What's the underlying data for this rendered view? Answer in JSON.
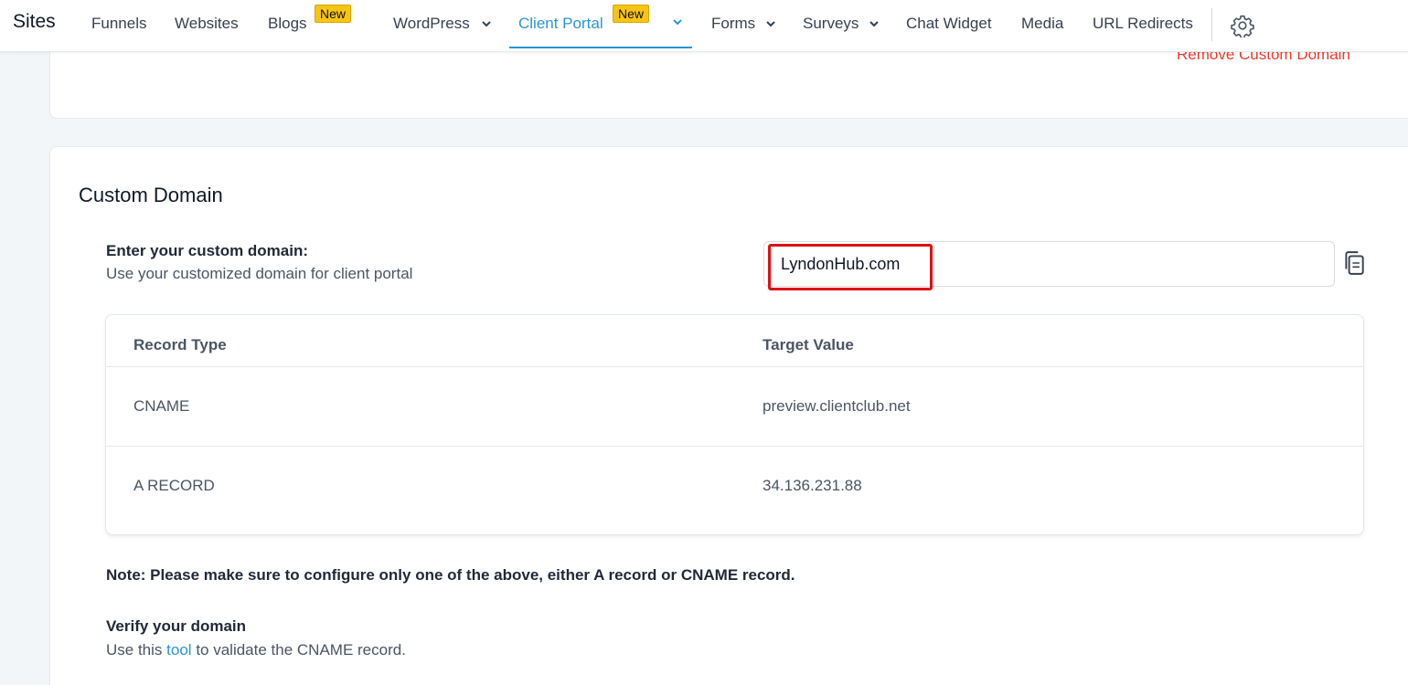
{
  "header": {
    "brand": "Sites",
    "nav": {
      "funnels": "Funnels",
      "websites": "Websites",
      "blogs": "Blogs",
      "blogs_badge": "New",
      "wordpress": "WordPress",
      "client_portal": "Client Portal",
      "client_portal_badge": "New",
      "forms": "Forms",
      "surveys": "Surveys",
      "chat_widget": "Chat Widget",
      "media": "Media",
      "url_redirects": "URL Redirects"
    }
  },
  "top_card": {
    "remove_link": "Remove Custom Domain"
  },
  "custom_domain": {
    "title": "Custom Domain",
    "label": "Enter your custom domain:",
    "help": "Use your customized domain for client portal",
    "value": "LyndonHub.com"
  },
  "dns_table": {
    "headers": [
      "Record Type",
      "Target Value"
    ],
    "rows": [
      [
        "CNAME",
        "preview.clientclub.net"
      ],
      [
        "A RECORD",
        "34.136.231.88"
      ]
    ]
  },
  "note": "Note: Please make sure to configure only one of the above, either A record or CNAME record.",
  "verify": {
    "title": "Verify your domain",
    "text_before": "Use this",
    "link": "tool",
    "text_after": "to validate the CNAME record."
  },
  "colors": {
    "accent": "#2a96d3",
    "danger": "#ef3b2d",
    "badge": "#f7c414",
    "highlight": "#e01010"
  },
  "icons": [
    "chevron-down-icon",
    "gear-icon",
    "copy-icon"
  ]
}
